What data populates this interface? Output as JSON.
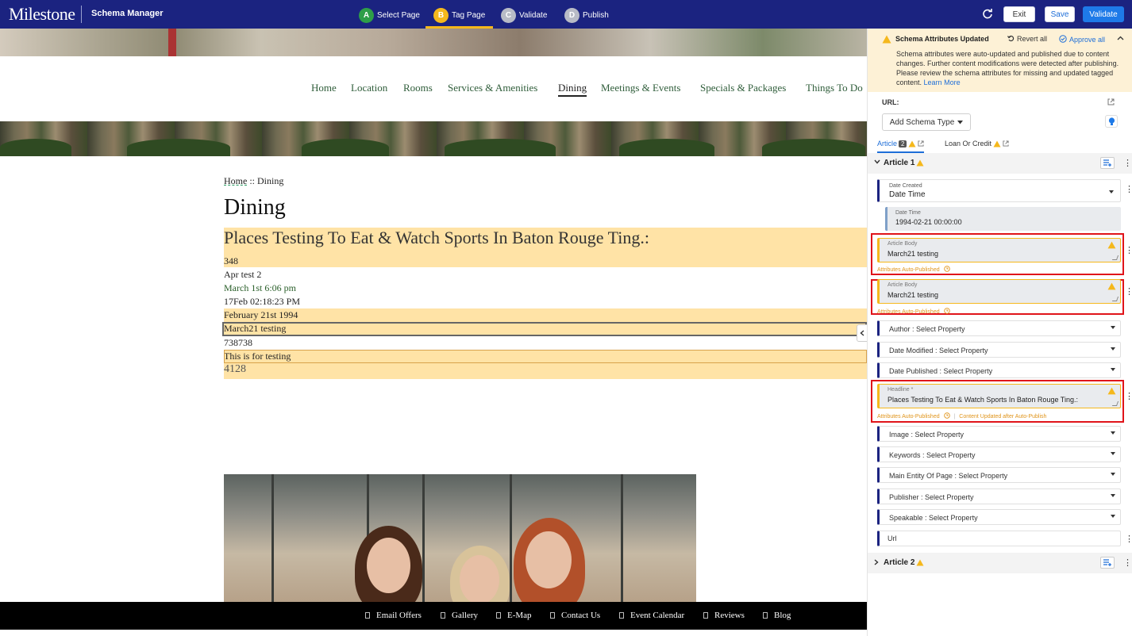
{
  "topbar": {
    "logo": "Milestone",
    "app_name": "Schema Manager",
    "steps": [
      {
        "letter": "A",
        "label": "Select Page",
        "color": "#2e9e48"
      },
      {
        "letter": "B",
        "label": "Tag Page",
        "color": "#f5b81c"
      },
      {
        "letter": "C",
        "label": "Validate",
        "color": "#b8bbc6"
      },
      {
        "letter": "D",
        "label": "Publish",
        "color": "#b8bbc6"
      }
    ],
    "exit_label": "Exit",
    "save_label": "Save",
    "validate_label": "Validate"
  },
  "site": {
    "nav": [
      "Home",
      "Location",
      "Rooms",
      "Services & Amenities",
      "Dining",
      "Meetings & Events",
      "Specials & Packages",
      "Things To Do"
    ],
    "active_nav": "Dining",
    "breadcrumb": {
      "home": "Home",
      "sep": "::",
      "current": "Dining"
    },
    "title": "Dining",
    "content_lines": [
      "Places Testing To Eat & Watch Sports In Baton Rouge Ting.:",
      "348",
      " Apr test 2",
      "March 1st 6:06 pm",
      "17Feb  02:18:23 PM",
      "February 21st 1994",
      "March21 testing",
      "738738",
      "This is for testing",
      "4128"
    ],
    "footer": [
      "Email Offers",
      "Gallery",
      "E-Map",
      "Contact Us",
      "Event Calendar",
      "Reviews",
      "Blog"
    ]
  },
  "panel": {
    "notice": {
      "title": "Schema Attributes Updated",
      "revert": "Revert all",
      "approve": "Approve all",
      "message": "Schema attributes were auto-updated and published due to content changes. Further content modifications were detected after publishing. Please review the schema attributes for missing and updated tagged content.",
      "learn_more": "Learn More"
    },
    "url_label": "URL:",
    "add_schema": "Add Schema Type",
    "tabs": [
      {
        "label": "Article",
        "count": "2"
      },
      {
        "label": "Loan Or Credit"
      }
    ],
    "article1": {
      "label": "Article 1",
      "date_created": {
        "label": "Date Created",
        "value": "Date Time"
      },
      "date_time": {
        "label": "Date Time",
        "value": "1994-02-21 00:00:00"
      },
      "article_body_1": {
        "label": "Article Body",
        "value": "March21 testing",
        "status": "Attributes Auto-Published"
      },
      "article_body_2": {
        "label": "Article Body",
        "value": "March21 testing",
        "status": "Attributes Auto-Published"
      },
      "author": "Author : Select Property",
      "date_modified": "Date Modified : Select Property",
      "date_published": "Date Published : Select Property",
      "headline": {
        "label": "Headline *",
        "value": "Places Testing To Eat & Watch Sports In Baton Rouge Ting.:",
        "status": "Attributes Auto-Published",
        "status2": "Content Updated after Auto-Publish"
      },
      "image": "Image : Select Property",
      "keywords": "Keywords : Select Property",
      "main_entity": "Main Entity Of Page : Select Property",
      "publisher": "Publisher : Select Property",
      "speakable": "Speakable : Select Property",
      "url": "Url"
    },
    "article2": {
      "label": "Article 2"
    }
  }
}
